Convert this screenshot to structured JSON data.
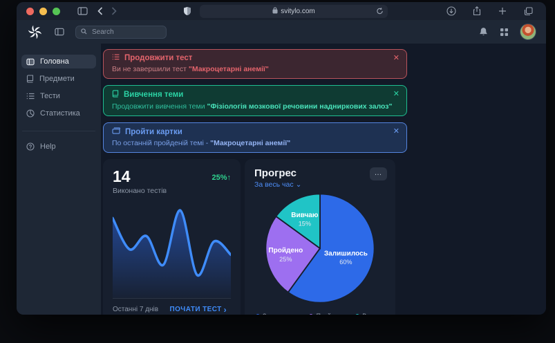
{
  "browser": {
    "url": "svitylo.com"
  },
  "header": {
    "search_placeholder": "Search"
  },
  "sidebar": {
    "items": [
      {
        "label": "Головна"
      },
      {
        "label": "Предмети"
      },
      {
        "label": "Тести"
      },
      {
        "label": "Статистика"
      }
    ],
    "help_label": "Help"
  },
  "alerts": [
    {
      "title": "Продовжити тест",
      "text": "Ви не завершили тест ",
      "highlight": "\"Макроцетарні анемії\""
    },
    {
      "title": "Вивчення теми",
      "text": "Продовжити вивчення теми ",
      "highlight": "\"Фізіологія мозкової речовини надниркових залоз\""
    },
    {
      "title": "Пройти картки",
      "text": "По останній пройденій темі - ",
      "highlight": "\"Макроцетарні анемії\""
    }
  ],
  "tests_card": {
    "count": "14",
    "change": "25%",
    "subtitle": "Виконано тестів",
    "period": "Останні 7 днів",
    "cta": "ПОЧАТИ ТЕСТ"
  },
  "progress_card": {
    "title": "Прогрес",
    "filter": "За весь час"
  },
  "colors": {
    "accent_blue": "#3f8cfa",
    "positive_green": "#2fd38f",
    "alert_red": "#e4646c",
    "alert_green": "#2bd3a4",
    "alert_blue": "#6a9bf0"
  },
  "chart_data": [
    {
      "type": "area",
      "title": "Виконано тестів",
      "period": "Останні 7 днів",
      "values": [
        85,
        45,
        62,
        25,
        95,
        12,
        55,
        38
      ],
      "value_scale": "relative 0-100, estimated from curve",
      "line_color": "#3f8cfa",
      "fill_color": "#2f6df0",
      "grid": false
    },
    {
      "type": "pie",
      "labels": [
        "Залишилось",
        "Пройдено",
        "Вивчаю"
      ],
      "values": [
        60,
        25,
        15
      ],
      "colors": [
        "#2d6ae8",
        "#9d6ff0",
        "#20c4c6"
      ],
      "legend_position": "bottom",
      "start_angle": "12 o'clock, clockwise"
    }
  ]
}
